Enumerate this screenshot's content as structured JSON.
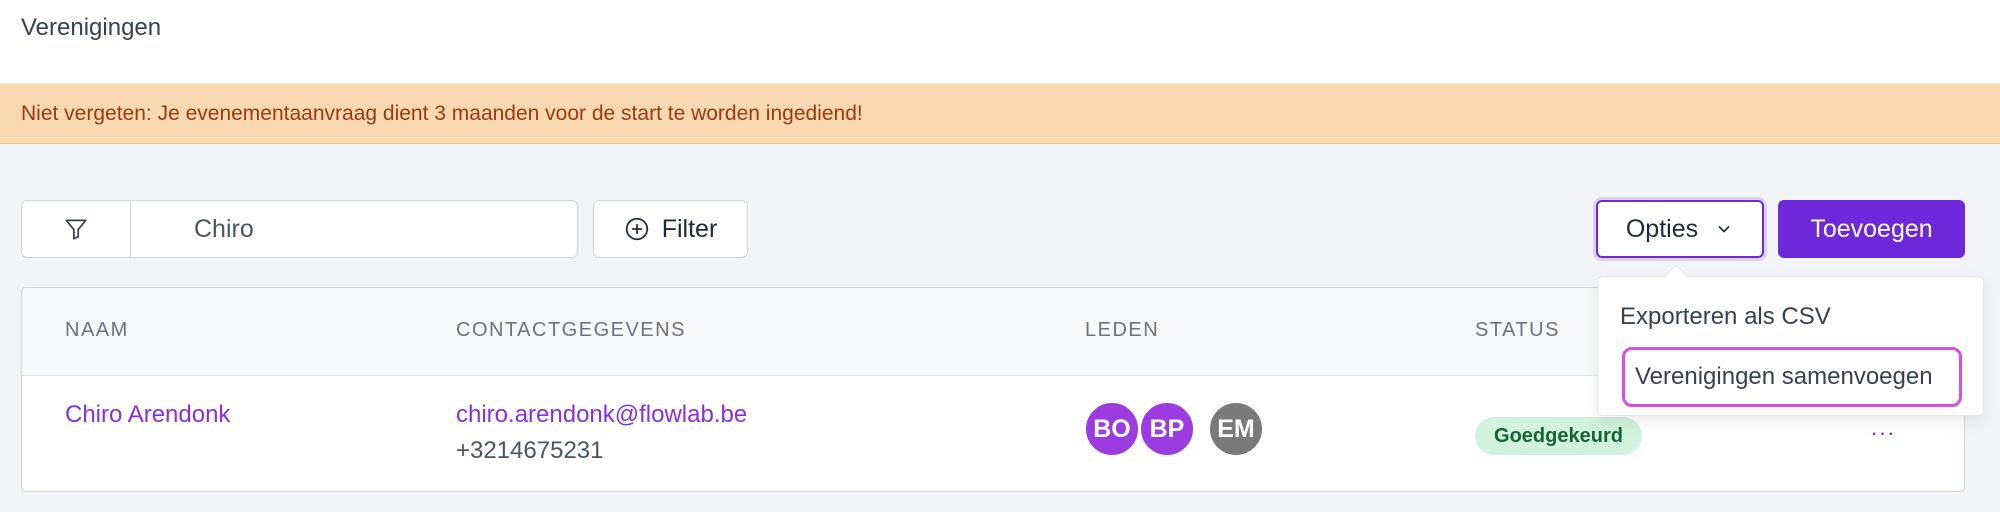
{
  "header": {
    "title": "Verenigingen"
  },
  "notice": {
    "text": "Niet vergeten: Je evenementaanvraag dient 3 maanden voor de start te worden ingediend!"
  },
  "toolbar": {
    "search_value": "Chiro",
    "filter_label": "Filter",
    "options_label": "Opties",
    "add_label": "Toevoegen"
  },
  "dropdown": {
    "items": [
      "Exporteren als CSV",
      "Verenigingen samenvoegen"
    ]
  },
  "table": {
    "columns": [
      "NAAM",
      "CONTACTGEGEVENS",
      "LEDEN",
      "STATUS"
    ],
    "rows": [
      {
        "name": "Chiro Arendonk",
        "email": "chiro.arendonk@flowlab.be",
        "phone": "+3214675231",
        "members": [
          {
            "initials": "BO",
            "color": "#9b3be0"
          },
          {
            "initials": "BP",
            "color": "#9b3be0"
          },
          {
            "initials": "EM",
            "color": "#7a7a7a"
          }
        ],
        "status": "Goedgekeurd",
        "actions_label": "···"
      }
    ]
  },
  "colors": {
    "primary": "#6d28d9",
    "link": "#8b2fd6",
    "notice_bg": "#f8d8b0",
    "notice_text": "#9a3a12",
    "badge_bg": "#d1f2dc",
    "badge_text": "#166534",
    "highlight": "#d94fe6"
  }
}
